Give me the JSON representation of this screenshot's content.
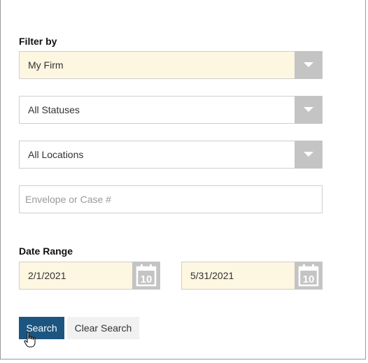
{
  "filter": {
    "label": "Filter by",
    "firm_select": {
      "value": "My Firm"
    },
    "status_select": {
      "value": "All Statuses"
    },
    "location_select": {
      "value": "All Locations"
    },
    "case_input": {
      "placeholder": "Envelope or Case #",
      "value": ""
    }
  },
  "date_range": {
    "label": "Date Range",
    "start": "2/1/2021",
    "end": "5/31/2021",
    "calendar_day": "10"
  },
  "actions": {
    "search_label": "Search",
    "clear_label": "Clear Search"
  },
  "icons": {
    "dropdown": "chevron-down-icon",
    "calendar": "calendar-icon",
    "pointer": "hand-pointer-cursor-icon"
  },
  "colors": {
    "highlight_bg": "#fdf6e1",
    "primary_button": "#1b5580",
    "secondary_button": "#f1f1f1",
    "addon_gray": "#c4c4c4"
  }
}
